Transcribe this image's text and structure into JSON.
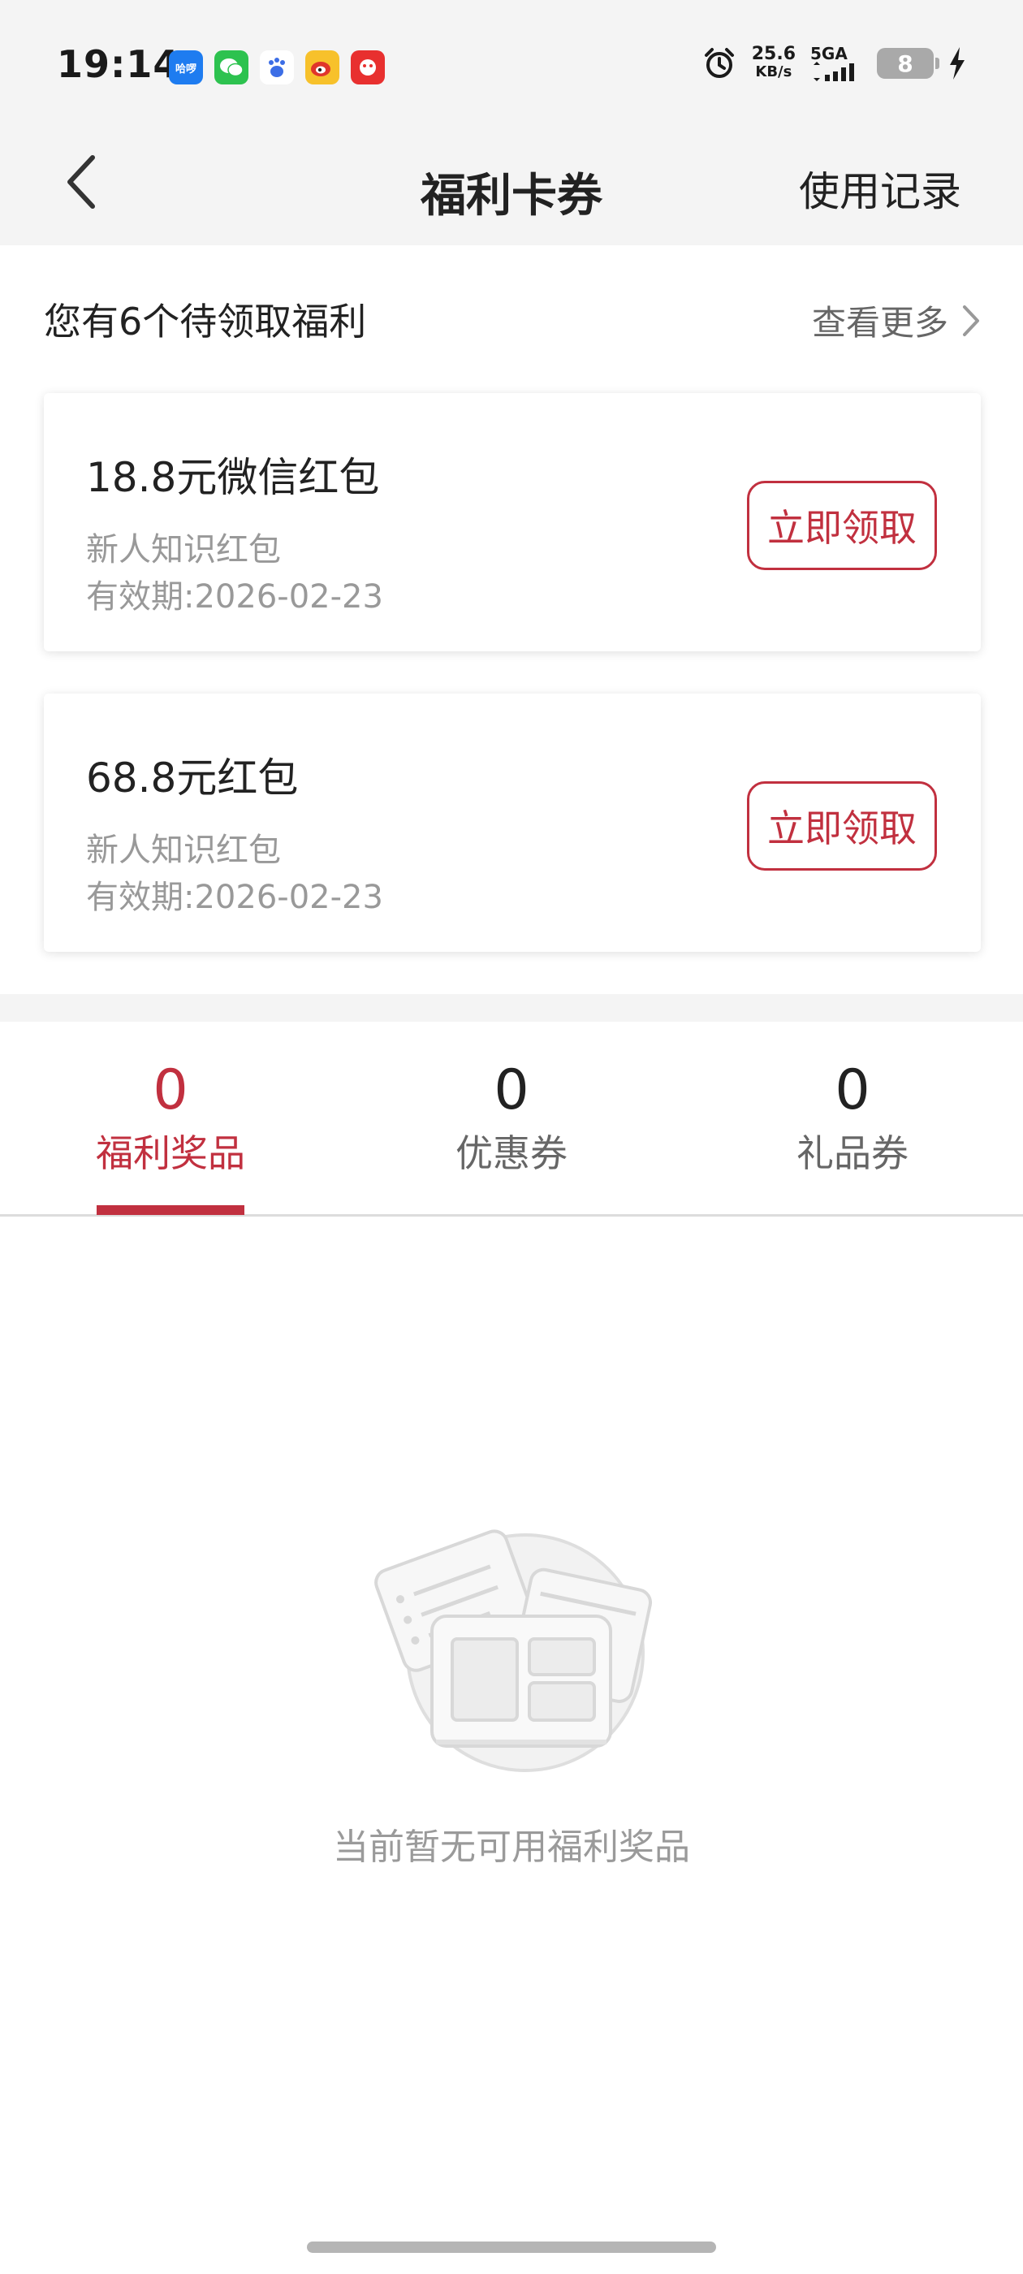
{
  "status_bar": {
    "time": "19:14",
    "apps": [
      "哈啰",
      "微信",
      "百度",
      "微博",
      "小红书"
    ],
    "speed_value": "25.6",
    "speed_unit": "KB/s",
    "network": "5GA",
    "battery": "8",
    "icons": [
      "alarm-icon",
      "signal-icon",
      "battery-icon",
      "charging-icon"
    ]
  },
  "nav": {
    "title": "福利卡券",
    "right_action": "使用记录",
    "back_icon": "chevron-left-icon"
  },
  "pending": {
    "heading": "您有6个待领取福利",
    "more_label": "查看更多",
    "cards": [
      {
        "title": "18.8元微信红包",
        "subtitle": "新人知识红包",
        "validity": "有效期:2026-02-23",
        "button": "立即领取"
      },
      {
        "title": "68.8元红包",
        "subtitle": "新人知识红包",
        "validity": "有效期:2026-02-23",
        "button": "立即领取"
      }
    ]
  },
  "tabs": [
    {
      "count": "0",
      "label": "福利奖品",
      "active": true
    },
    {
      "count": "0",
      "label": "优惠券",
      "active": false
    },
    {
      "count": "0",
      "label": "礼品券",
      "active": false
    }
  ],
  "empty_state": {
    "text": "当前暂无可用福利奖品",
    "icon": "empty-coupons-illustration"
  },
  "colors": {
    "accent": "#c1303f",
    "background_gray": "#f4f4f4",
    "muted_text": "#999999"
  }
}
